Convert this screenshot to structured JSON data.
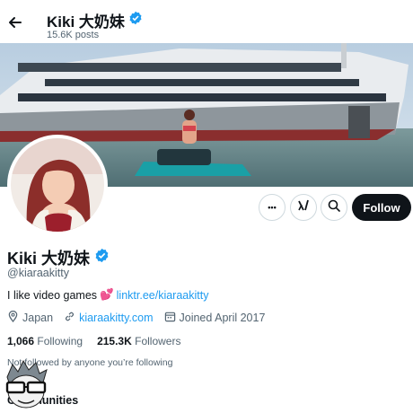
{
  "header": {
    "name": "Kiki 大奶妹",
    "posts": "15.6K posts"
  },
  "actions": {
    "more_symbol": "•••",
    "follow_label": "Follow"
  },
  "profile": {
    "name": "Kiki 大奶妹",
    "handle": "@kiaraakitty",
    "bio_text": "I like video games",
    "bio_emoji": "💕",
    "bio_link": "linktr.ee/kiaraakitty",
    "location": "Japan",
    "website": "kiaraakitty.com",
    "joined": "Joined April 2017",
    "following_count": "1,066",
    "following_label": "Following",
    "followers_count": "215.3K",
    "followers_label": "Followers",
    "followed_by_note": "Not followed by anyone you’re following",
    "communities_label": "Communities"
  },
  "colors": {
    "accent": "#1d9bf0",
    "text": "#0f1419",
    "muted": "#536471",
    "follow_bg": "#0f1419"
  },
  "icons": [
    "back-arrow-icon",
    "verified-badge-icon",
    "more-icon",
    "grok-icon",
    "search-icon",
    "location-icon",
    "link-icon",
    "calendar-icon"
  ]
}
